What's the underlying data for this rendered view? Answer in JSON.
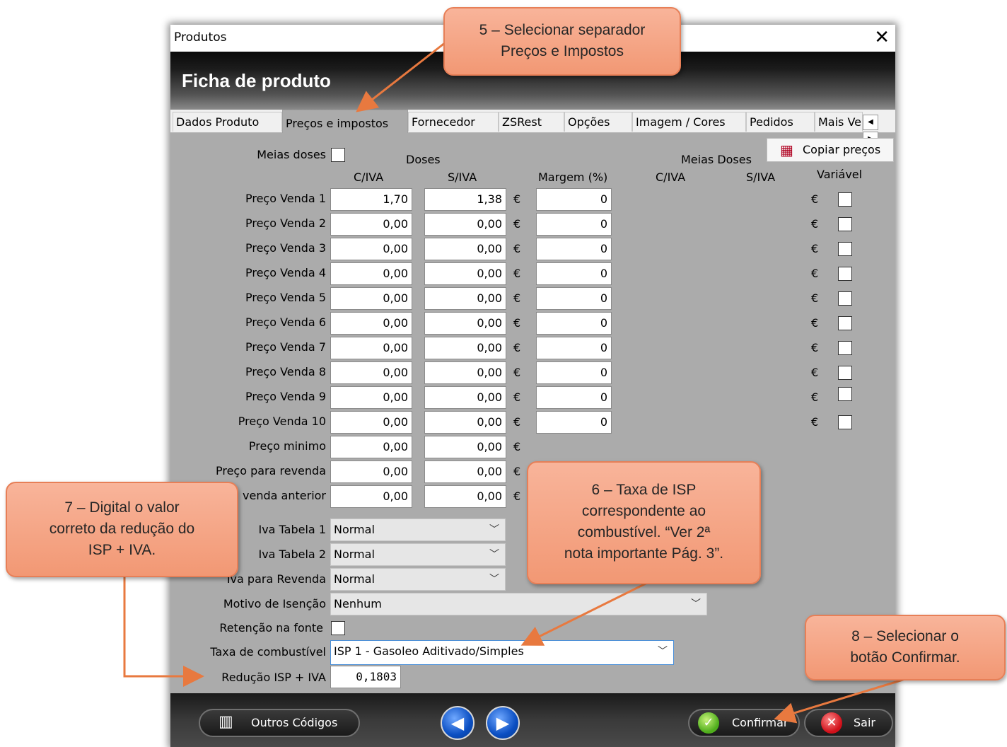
{
  "window": {
    "title": "Produtos",
    "close_glyph": "✕"
  },
  "header": {
    "title": "Ficha de produto"
  },
  "tabs": [
    "Dados Produto",
    "Preços e impostos",
    "Fornecedor",
    "ZSRest",
    "Opções",
    "Imagem / Cores",
    "Pedidos",
    "Mais Ve"
  ],
  "active_tab": "Preços e impostos",
  "meias_doses_label": "Meias doses",
  "copy_prices_label": "Copiar preços",
  "headers": {
    "doses": "Doses",
    "meias_doses": "Meias Doses",
    "civa": "C/IVA",
    "siva": "S/IVA",
    "margem": "Margem (%)",
    "meias_civa": "C/IVA",
    "meias_siva": "S/IVA",
    "variavel": "Variável"
  },
  "currency": "€",
  "price_rows": [
    {
      "label": "Preço Venda 1",
      "civa": "1,70",
      "siva": "1,38",
      "margem": "0"
    },
    {
      "label": "Preço Venda 2",
      "civa": "0,00",
      "siva": "0,00",
      "margem": "0"
    },
    {
      "label": "Preço Venda 3",
      "civa": "0,00",
      "siva": "0,00",
      "margem": "0"
    },
    {
      "label": "Preço Venda 4",
      "civa": "0,00",
      "siva": "0,00",
      "margem": "0"
    },
    {
      "label": "Preço Venda 5",
      "civa": "0,00",
      "siva": "0,00",
      "margem": "0"
    },
    {
      "label": "Preço Venda 6",
      "civa": "0,00",
      "siva": "0,00",
      "margem": "0"
    },
    {
      "label": "Preço Venda 7",
      "civa": "0,00",
      "siva": "0,00",
      "margem": "0"
    },
    {
      "label": "Preço Venda 8",
      "civa": "0,00",
      "siva": "0,00",
      "margem": "0"
    },
    {
      "label": "Preço Venda 9",
      "civa": "0,00",
      "siva": "0,00",
      "margem": "0"
    },
    {
      "label": "Preço Venda 10",
      "civa": "0,00",
      "siva": "0,00",
      "margem": "0"
    }
  ],
  "extra_rows": [
    {
      "label": "Preço minimo",
      "civa": "0,00",
      "siva": "0,00"
    },
    {
      "label": "Preço para revenda",
      "civa": "0,00",
      "siva": "0,00"
    },
    {
      "label": "venda anterior",
      "civa": "0,00",
      "siva": "0,00"
    }
  ],
  "iva": {
    "tabela1": {
      "label": "Iva Tabela 1",
      "value": "Normal"
    },
    "tabela2": {
      "label": "Iva Tabela 2",
      "value": "Normal"
    },
    "revenda": {
      "label": "Iva para Revenda",
      "value": "Normal"
    }
  },
  "isencao": {
    "label": "Motivo de Isenção",
    "value": "Nenhum"
  },
  "retencao_label": "Retenção na fonte",
  "combustivel": {
    "label": "Taxa de combustível",
    "value": "ISP 1 - Gasoleo Aditivado/Simples"
  },
  "reducao": {
    "label": "Redução ISP + IVA",
    "value": "0,1803"
  },
  "footer": {
    "outros": "Outros Códigos",
    "confirmar": "Confirmar",
    "sair": "Sair"
  },
  "callouts": {
    "c5": [
      "5 – Selecionar separador",
      "Preços e Impostos"
    ],
    "c6": [
      "6 – Taxa de ISP",
      "correspondente ao",
      "combustível. “Ver 2ª",
      "nota importante Pág. 3”."
    ],
    "c7": [
      "7 – Digital o valor",
      "correto da redução do",
      "ISP + IVA."
    ],
    "c8": [
      "8 – Selecionar o",
      "botão Confirmar."
    ]
  },
  "colors": {
    "callout": "#f4a07f",
    "arrow": "#e8793f",
    "panel": "#ababab"
  }
}
